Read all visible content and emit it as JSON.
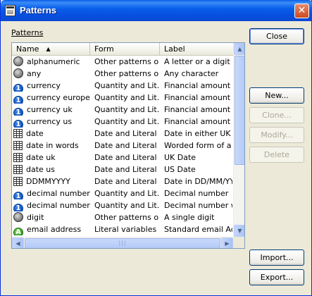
{
  "window": {
    "title": "Patterns",
    "close_glyph": "✕"
  },
  "group_label": "Patterns",
  "list": {
    "columns": [
      "Name",
      "Form",
      "Label"
    ],
    "sort_column": "Name",
    "sort_direction": "ascending",
    "rows": [
      {
        "icon": "gray-circle-icon",
        "name": "alphanumeric",
        "form": "Other patterns o...",
        "label": "A letter or a digit"
      },
      {
        "icon": "gray-circle-icon",
        "name": "any",
        "form": "Other patterns o...",
        "label": "Any character"
      },
      {
        "icon": "blue-info-icon",
        "name": "currency",
        "form": "Quantity and Lit...",
        "label": "Financial amount po"
      },
      {
        "icon": "blue-info-icon",
        "name": "currency europe",
        "form": "Quantity and Lit...",
        "label": "Financial amount po"
      },
      {
        "icon": "blue-info-icon",
        "name": "currency uk",
        "form": "Quantity and Lit...",
        "label": "Financial amount po"
      },
      {
        "icon": "blue-info-icon",
        "name": "currency us",
        "form": "Quantity and Lit...",
        "label": "Financial amount po"
      },
      {
        "icon": "grid-icon",
        "name": "date",
        "form": "Date and Literal ...",
        "label": "Date in either UK or"
      },
      {
        "icon": "grid-icon",
        "name": "date in words",
        "form": "Date and Literal ...",
        "label": "Worded form of a da"
      },
      {
        "icon": "grid-icon",
        "name": "date uk",
        "form": "Date and Literal ...",
        "label": "UK Date"
      },
      {
        "icon": "grid-icon",
        "name": "date us",
        "form": "Date and Literal ...",
        "label": "US Date"
      },
      {
        "icon": "grid-icon",
        "name": "DDMMYYYY",
        "form": "Date and Literal ...",
        "label": "Date in DD/MM/YY"
      },
      {
        "icon": "blue-info-icon",
        "name": "decimal number",
        "form": "Quantity and Lit...",
        "label": "Decimal number"
      },
      {
        "icon": "blue-info-icon",
        "name": "decimal number ...",
        "form": "Quantity and Lit...",
        "label": "Decimal number with"
      },
      {
        "icon": "gray-circle-icon",
        "name": "digit",
        "form": "Other patterns o...",
        "label": "A single digit"
      },
      {
        "icon": "green-a-icon",
        "name": "email address",
        "form": "Literal variables",
        "label": "Standard email Addr"
      }
    ]
  },
  "buttons": {
    "close": "Close",
    "new": "New...",
    "clone": "Clone...",
    "modify": "Modify...",
    "delete": "Delete",
    "import": "Import...",
    "export": "Export..."
  },
  "button_states": {
    "clone": "disabled",
    "modify": "disabled",
    "delete": "disabled"
  },
  "icon_glyphs": {
    "blue-info-icon": "1",
    "green-a-icon": "A"
  },
  "scroll_glyphs": {
    "up": "▲",
    "down": "▼",
    "left": "◀",
    "right": "▶",
    "grip": "|||"
  }
}
